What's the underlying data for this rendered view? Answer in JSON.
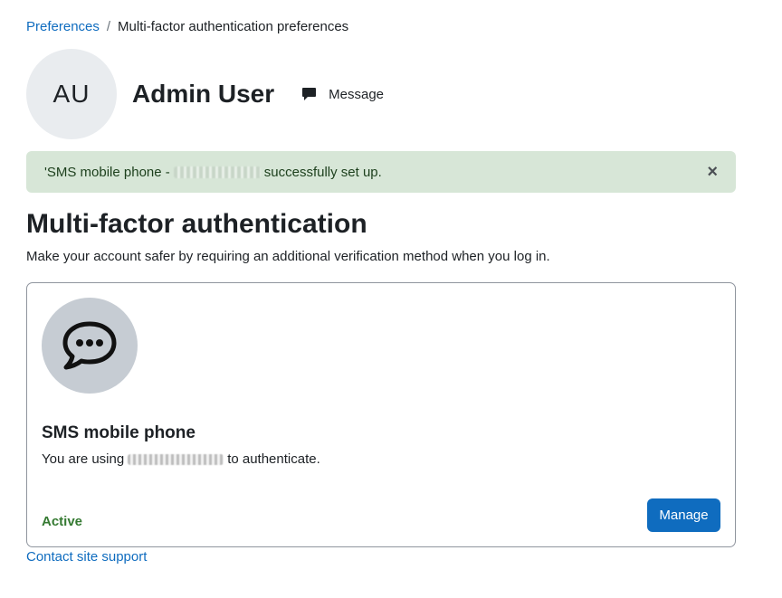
{
  "breadcrumb": {
    "parent": "Preferences",
    "separator": "/",
    "current": "Multi-factor authentication preferences"
  },
  "profile": {
    "initials": "AU",
    "name": "Admin User",
    "message_label": "Message"
  },
  "alert": {
    "text_before": "'SMS mobile phone - ",
    "text_after": " successfully set up.",
    "close_glyph": "×",
    "close_icon": "close-icon"
  },
  "main": {
    "title": "Multi-factor authentication",
    "description": "Make your account safer by requiring an additional verification method when you log in."
  },
  "factor_card": {
    "icon": "chat-bubble-icon",
    "title": "SMS mobile phone",
    "text_before": "You are using ",
    "text_after": " to authenticate.",
    "status": "Active",
    "manage_label": "Manage"
  },
  "footer": {
    "support_link": "Contact site support"
  },
  "colors": {
    "link": "#0f6cbf",
    "primary_button": "#0f6cbf",
    "success_bg": "#d7e6d7",
    "active_status": "#357a32"
  }
}
